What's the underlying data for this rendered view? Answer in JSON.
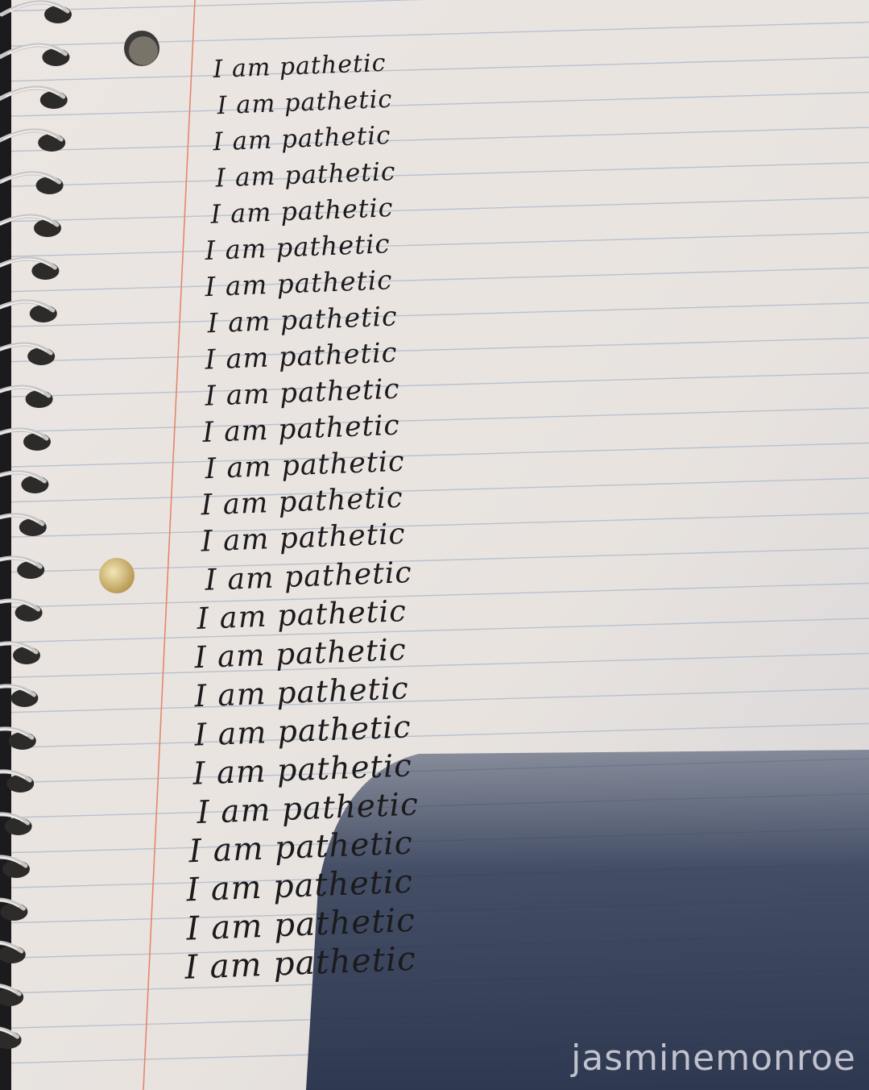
{
  "notebook": {
    "lines": [
      "I am pathetic",
      "I am pathetic",
      "I am pathetic",
      "I am pathetic",
      "I am pathetic",
      "I am pathetic",
      "I am pathetic",
      "I am pathetic",
      "I am pathetic",
      "I am pathetic",
      "I am pathetic",
      "I am pathetic",
      "I am pathetic",
      "I am pathetic",
      "I am pathetic",
      "I am pathetic",
      "I am pathetic",
      "I am pathetic",
      "I am pathetic",
      "I am pathetic",
      "I am pathetic",
      "I am pathetic",
      "I am pathetic",
      "I am pathetic",
      "I am pathetic"
    ],
    "watermark": "jasminemonroe",
    "colors": {
      "paper": "#e9e4e0",
      "rule": "#b9c3cf",
      "margin": "#e2876f",
      "ink": "#1b1a1c",
      "shadow": "#2b3852"
    }
  }
}
